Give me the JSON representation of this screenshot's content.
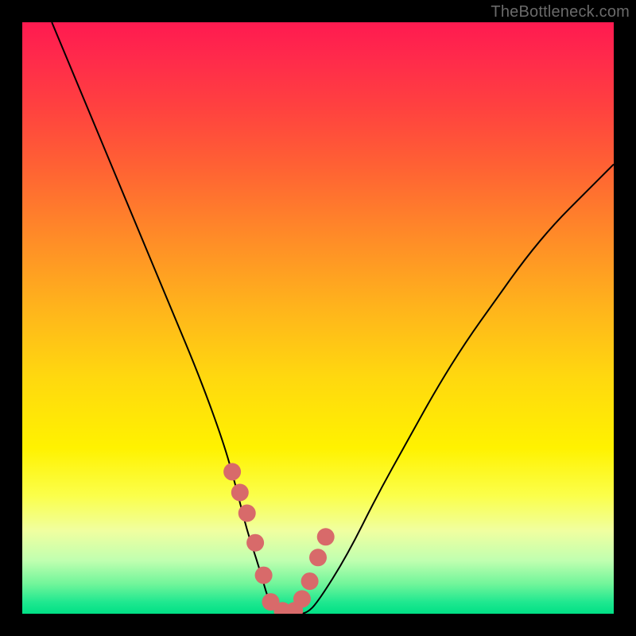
{
  "watermark": "TheBottleneck.com",
  "chart_data": {
    "type": "line",
    "title": "",
    "xlabel": "",
    "ylabel": "",
    "xlim": [
      0,
      100
    ],
    "ylim": [
      0,
      100
    ],
    "grid": false,
    "series": [
      {
        "name": "curve",
        "x": [
          5,
          10,
          15,
          20,
          25,
          30,
          34,
          36,
          38,
          40,
          42,
          44,
          46,
          48,
          50,
          55,
          60,
          65,
          70,
          75,
          80,
          85,
          90,
          95,
          100
        ],
        "values": [
          100,
          88,
          76,
          64,
          52,
          40,
          29,
          22,
          14,
          8,
          1,
          0,
          0,
          0,
          2,
          10,
          20,
          29,
          38,
          46,
          53,
          60,
          66,
          71,
          76
        ]
      }
    ],
    "markers": {
      "name": "highlight-points",
      "x": [
        35.5,
        36.8,
        38.0,
        39.4,
        40.8,
        42.0,
        44.0,
        46.0,
        47.3,
        48.6,
        50.0,
        51.3
      ],
      "values": [
        24,
        20.5,
        17,
        12,
        6.5,
        2,
        0.5,
        0.5,
        2.5,
        5.5,
        9.5,
        13
      ]
    },
    "colors": {
      "curve": "#000000",
      "markers": "#d86a6a",
      "gradient_top": "#ff1a50",
      "gradient_bottom": "#00e085"
    }
  }
}
